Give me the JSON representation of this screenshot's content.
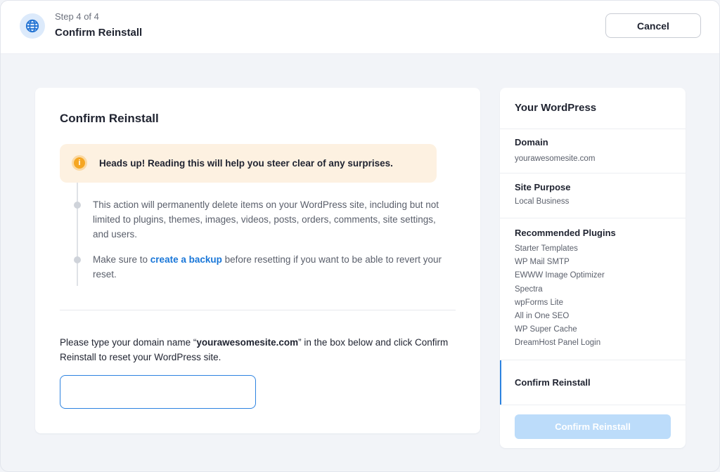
{
  "header": {
    "step": "Step 4 of 4",
    "title": "Confirm Reinstall",
    "cancel_label": "Cancel",
    "icon": "globe-icon"
  },
  "main": {
    "title": "Confirm Reinstall",
    "alert": {
      "icon": "info-icon",
      "icon_glyph": "i",
      "text": "Heads up! Reading this will help you steer clear of any surprises."
    },
    "warnings": {
      "item1": "This action will permanently delete items on your WordPress site, including but not limited to plugins, themes, images, videos, posts, orders, comments, site settings, and users.",
      "item2_before": "Make sure to ",
      "item2_link": "create a backup",
      "item2_after": " before resetting if you want to be able to revert your reset."
    },
    "instruction": {
      "before": "Please type your domain name “",
      "domain": "yourawesomesite.com",
      "after": "” in the box below and click Confirm Reinstall to reset your WordPress site."
    },
    "input": {
      "value": "",
      "placeholder": ""
    }
  },
  "sidebar": {
    "title": "Your WordPress",
    "domain_label": "Domain",
    "domain_value": "yourawesomesite.com",
    "purpose_label": "Site Purpose",
    "purpose_value": "Local Business",
    "plugins_label": "Recommended Plugins",
    "plugins": [
      "Starter Templates",
      "WP Mail SMTP",
      "EWWW Image Optimizer",
      "Spectra",
      "wpForms Lite",
      "All in One SEO",
      "WP Super Cache",
      "DreamHost Panel Login"
    ],
    "active_step": "Confirm Reinstall",
    "confirm_label": "Confirm Reinstall"
  },
  "colors": {
    "accent": "#2d83e0",
    "link": "#1876d8",
    "alert_bg": "#fdf1e1",
    "alert_icon": "#f5a623",
    "confirm_disabled": "#bcdcfa",
    "background": "#f2f4f8"
  }
}
